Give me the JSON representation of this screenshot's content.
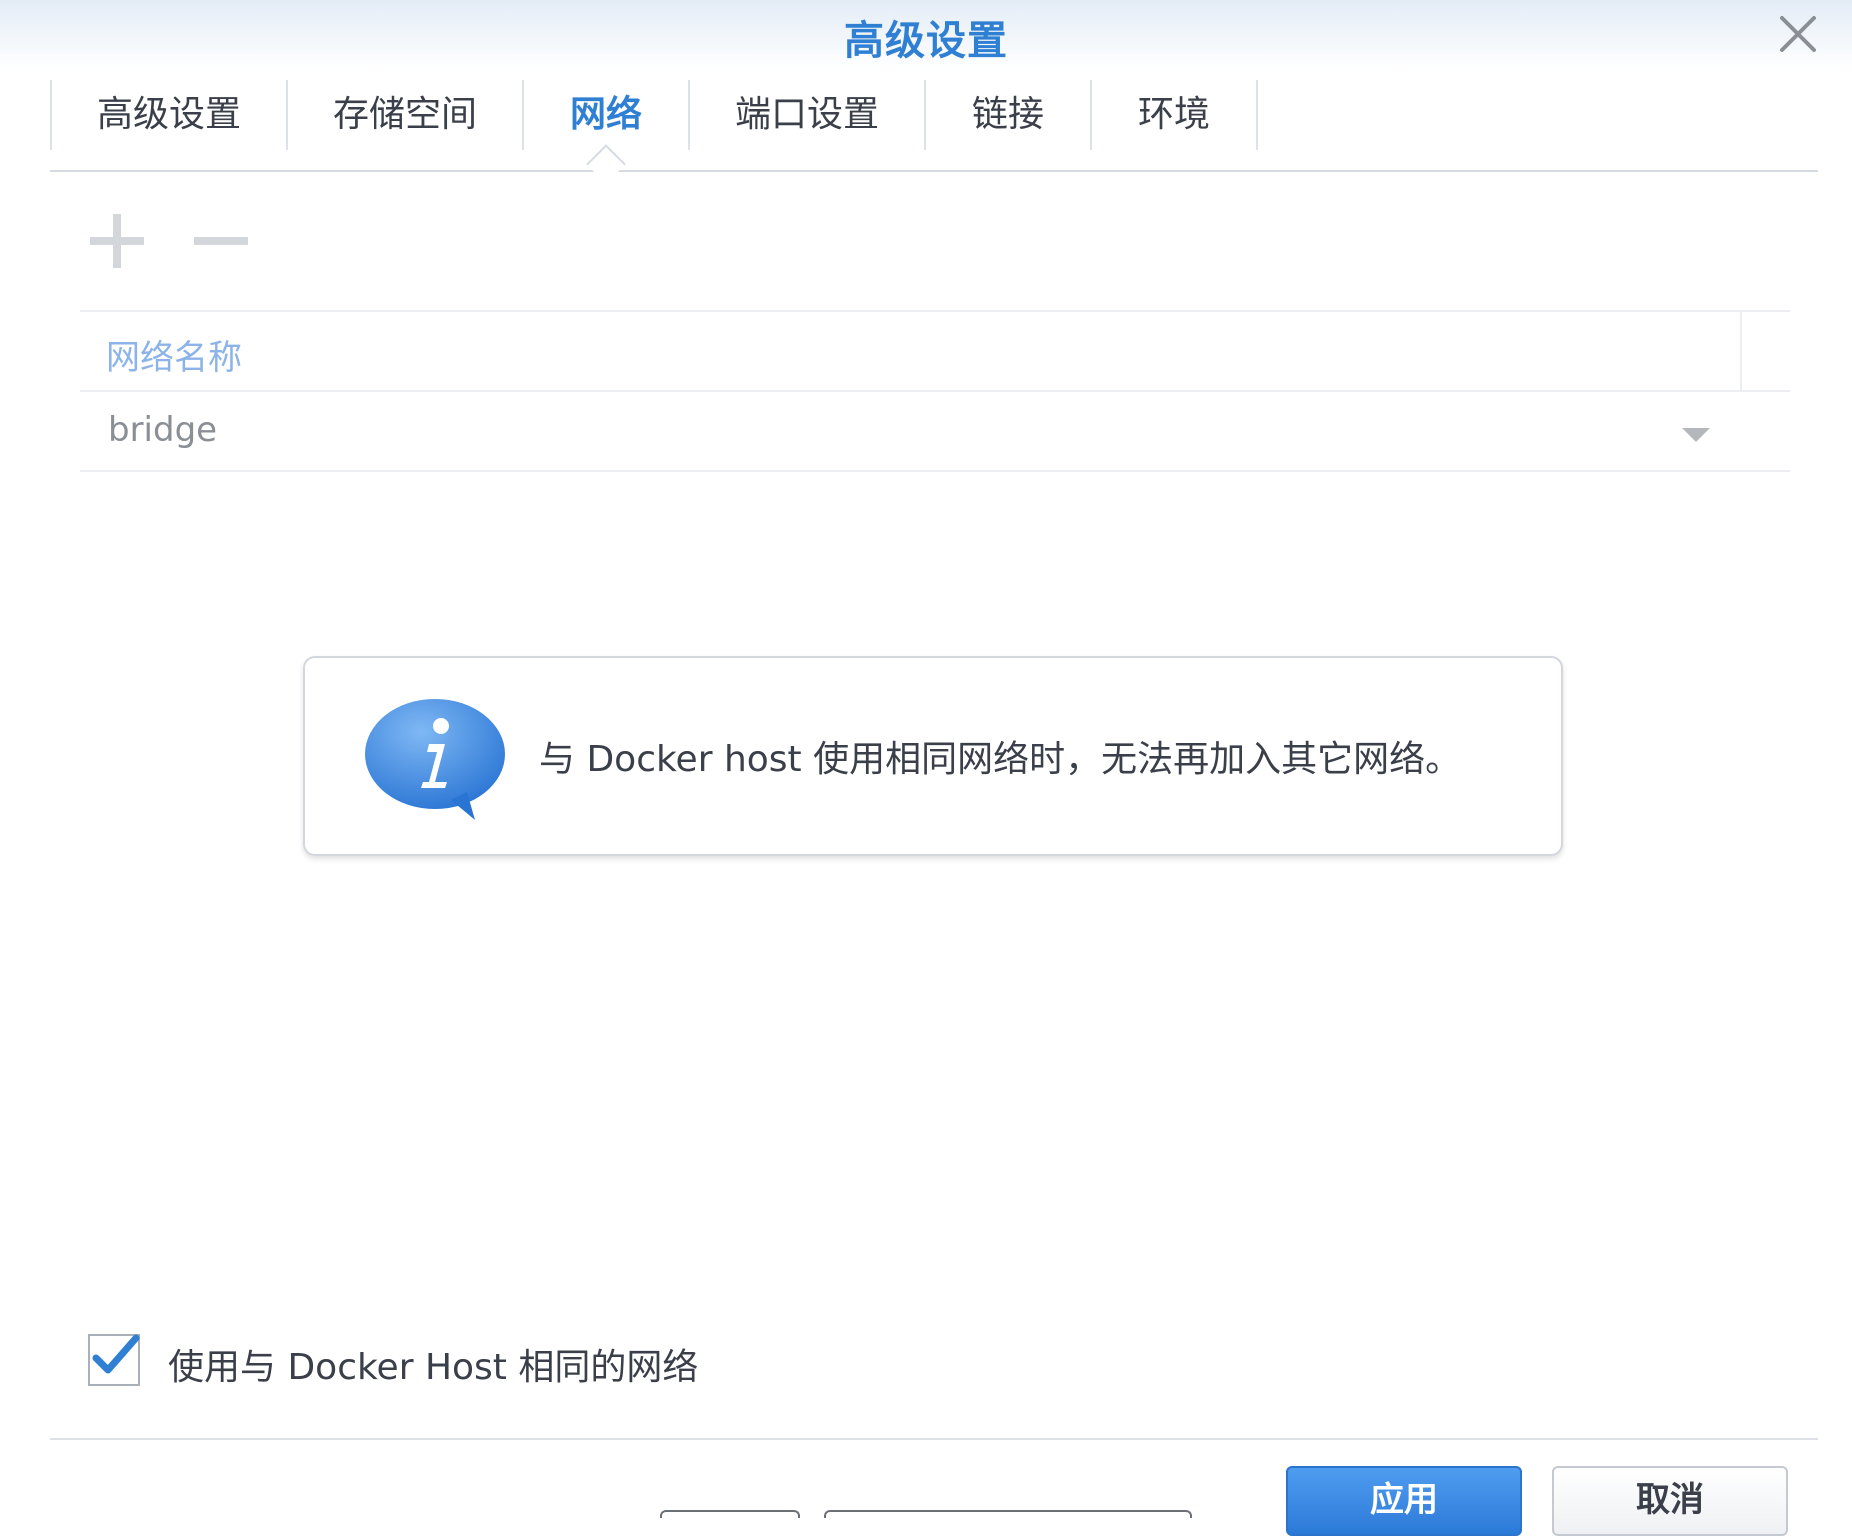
{
  "dialog": {
    "title": "高级设置",
    "close_icon": "close-icon"
  },
  "tabs": [
    {
      "label": "高级设置",
      "active": false
    },
    {
      "label": "存储空间",
      "active": false
    },
    {
      "label": "网络",
      "active": true
    },
    {
      "label": "端口设置",
      "active": false
    },
    {
      "label": "链接",
      "active": false
    },
    {
      "label": "环境",
      "active": false
    }
  ],
  "toolbar": {
    "add_icon": "plus-icon",
    "remove_icon": "minus-icon"
  },
  "network_grid": {
    "column_header": "网络名称",
    "rows": [
      {
        "name": "bridge"
      }
    ]
  },
  "info": {
    "icon": "info-icon",
    "message": "与 Docker host 使用相同网络时，无法再加入其它网络。"
  },
  "options": {
    "use_host_network_label": "使用与 Docker Host 相同的网络",
    "use_host_network_checked": true
  },
  "footer": {
    "apply_label": "应用",
    "cancel_label": "取消"
  },
  "colors": {
    "accent": "#2f7fd3",
    "header_text": "#8db4e8"
  }
}
